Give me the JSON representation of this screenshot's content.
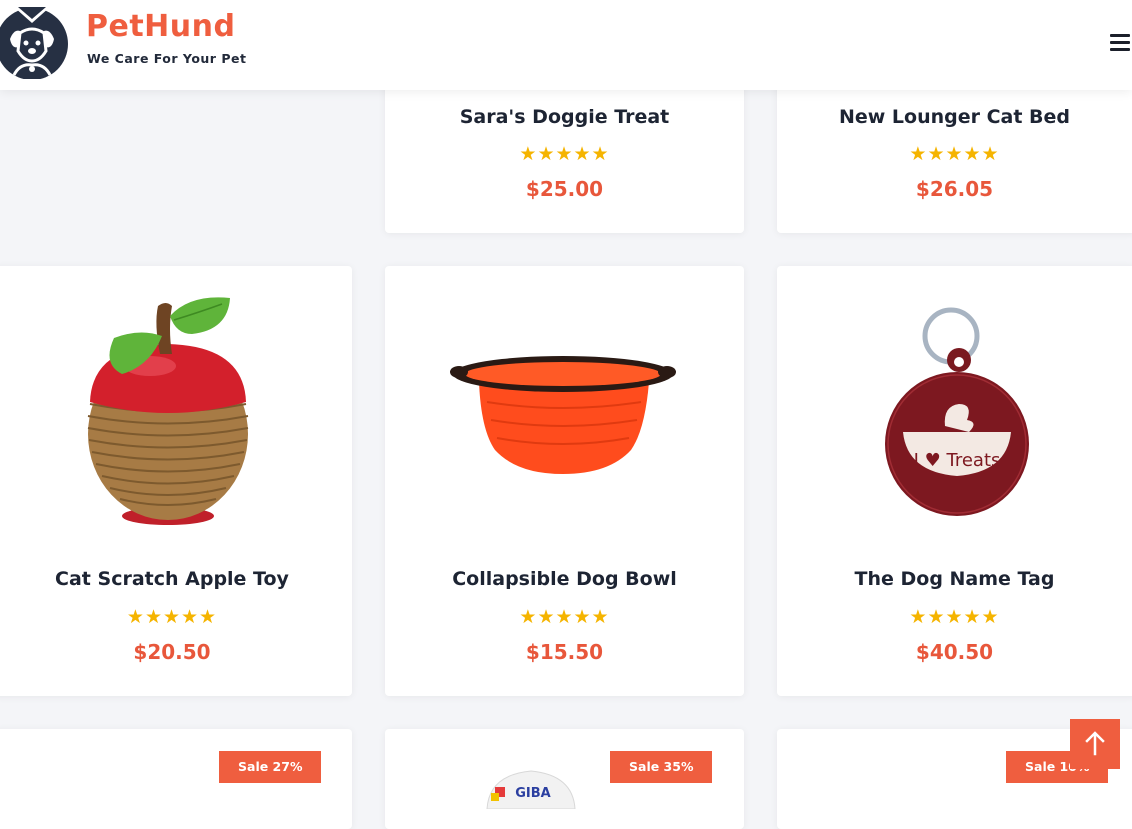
{
  "header": {
    "brand_name": "PetHund",
    "tagline": "We Care For Your Pet",
    "logo_icon": "dog-face-icon",
    "menu_icon": "hamburger-menu-icon"
  },
  "colors": {
    "accent": "#ef5e3f",
    "price": "#e8573b",
    "star": "#f5b400",
    "title": "#1d2433"
  },
  "rating_stars": "★★★★★",
  "products_row1": [
    {
      "title": "Sara's Doggie Treat",
      "price": "$25.00",
      "rating": 5
    },
    {
      "title": "New Lounger Cat Bed",
      "price": "$26.05",
      "rating": 5
    }
  ],
  "products_row2": [
    {
      "title": "Cat Scratch Apple Toy",
      "price": "$20.50",
      "rating": 5,
      "image": "apple-scratch-toy-image"
    },
    {
      "title": "Collapsible Dog Bowl",
      "price": "$15.50",
      "rating": 5,
      "image": "collapsible-bowl-image"
    },
    {
      "title": "The Dog Name Tag",
      "price": "$40.50",
      "rating": 5,
      "image": "name-tag-image",
      "tag_text": "I ♥ Treats"
    }
  ],
  "products_row3": [
    {
      "sale_label": "Sale 27%"
    },
    {
      "sale_label": "Sale 35%",
      "image_text": "GIBA"
    },
    {
      "sale_label": "Sale 10%"
    }
  ],
  "back_to_top_icon": "arrow-up-icon"
}
